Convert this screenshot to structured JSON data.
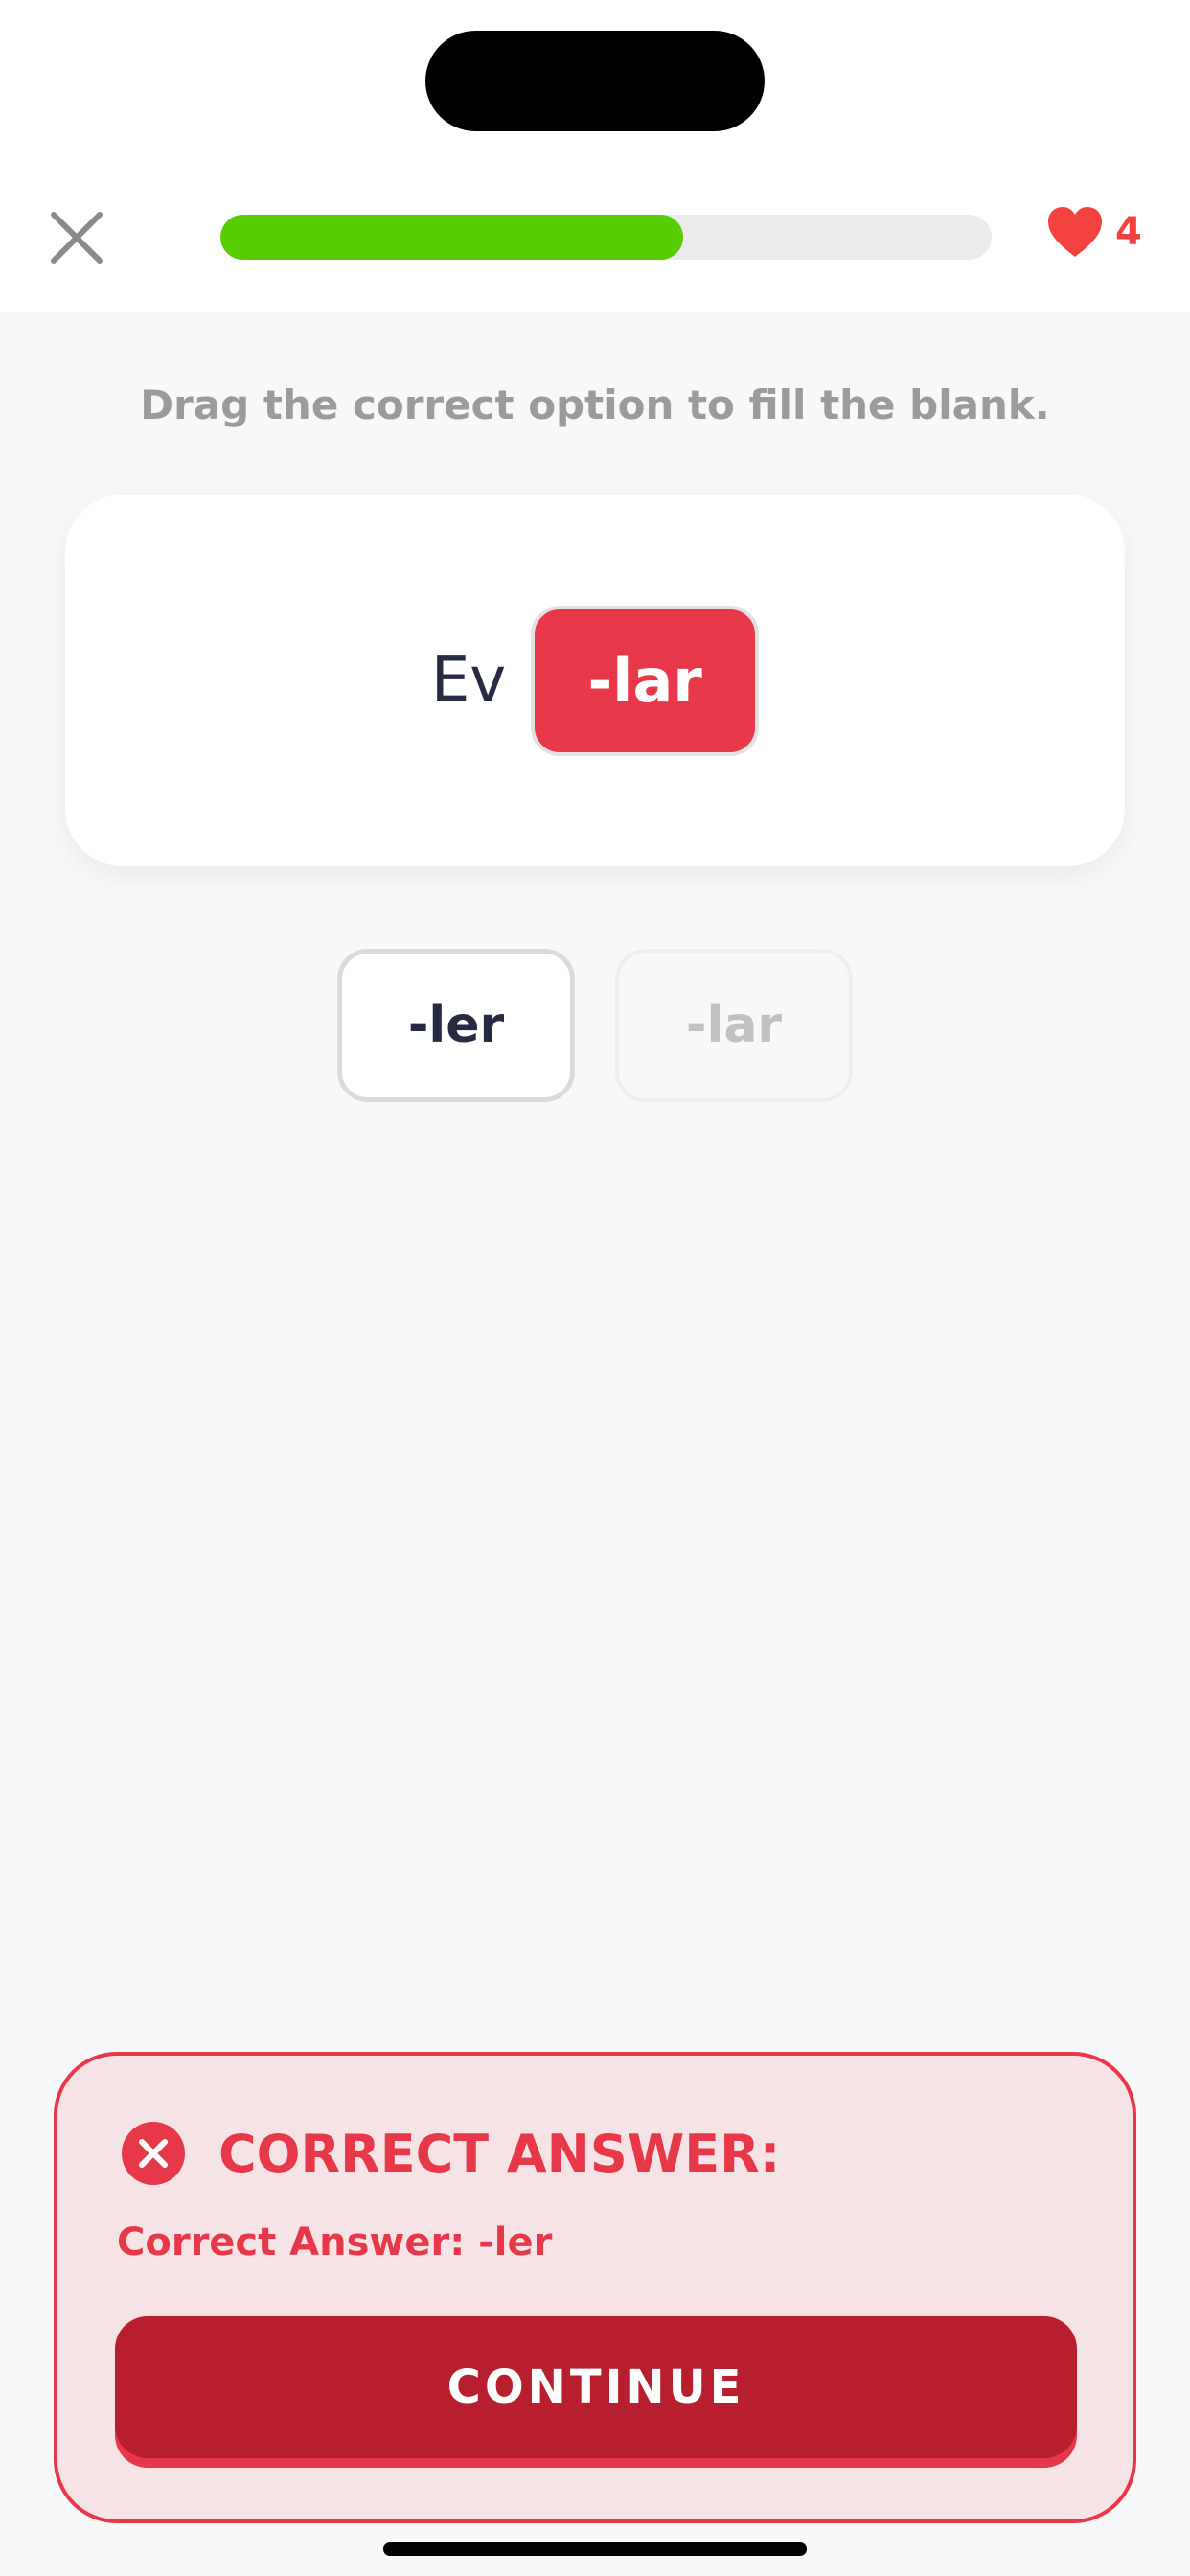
{
  "header": {
    "close_icon": "close-icon",
    "progress_fraction": 0.6,
    "hearts_icon": "heart-icon",
    "hearts_count": "4"
  },
  "exercise": {
    "instruction": "Drag the correct option to fill the blank.",
    "sentence_word": "Ev",
    "filled_answer": "-lar",
    "options": [
      "-ler",
      "-lar"
    ]
  },
  "feedback": {
    "title": "CORRECT ANSWER:",
    "detail": "Correct Answer: -ler",
    "continue_label": "CONTINUE",
    "status_icon": "error-icon"
  },
  "colors": {
    "accent_red": "#e7384a",
    "progress_green": "#58cc02",
    "continue_dark_red": "#b71f2f",
    "heart_red": "#f2413f"
  }
}
